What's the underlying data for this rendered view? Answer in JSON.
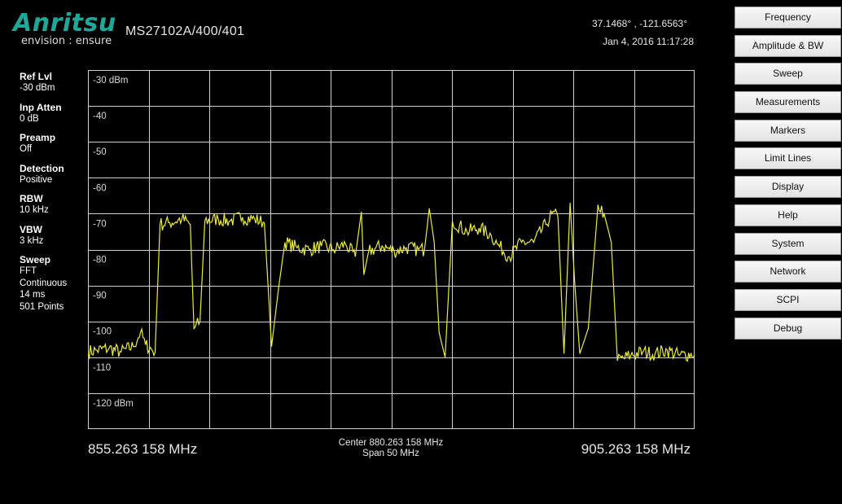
{
  "header": {
    "logo_text": "Anritsu",
    "tagline": "envision : ensure",
    "model": "MS27102A/400/401",
    "gps": "37.1468° , -121.6563°",
    "datetime": "Jan 4, 2016 11:17:28"
  },
  "params": [
    {
      "label": "Ref Lvl",
      "values": [
        "-30 dBm"
      ]
    },
    {
      "label": "Inp Atten",
      "values": [
        "0 dB"
      ]
    },
    {
      "label": "Preamp",
      "values": [
        "Off"
      ]
    },
    {
      "label": "Detection",
      "values": [
        "Positive"
      ]
    },
    {
      "label": "RBW",
      "values": [
        "10 kHz"
      ]
    },
    {
      "label": "VBW",
      "values": [
        "3 kHz"
      ]
    },
    {
      "label": "Sweep",
      "values": [
        "FFT",
        "Continuous",
        "14 ms",
        "501 Points"
      ]
    }
  ],
  "axis": {
    "y_labels": [
      "-30 dBm",
      "-40",
      "-50",
      "-60",
      "-70",
      "-80",
      "-90",
      "-100",
      "-110",
      "-120 dBm"
    ],
    "start_freq": "855.263 158 MHz",
    "stop_freq": "905.263 158 MHz",
    "center": "Center 880.263 158 MHz",
    "span": "Span 50 MHz"
  },
  "menu": [
    "Frequency",
    "Amplitude & BW",
    "Sweep",
    "Measurements",
    "Markers",
    "Limit Lines",
    "Display",
    "Help",
    "System",
    "Network",
    "SCPI",
    "Debug"
  ],
  "colors": {
    "trace": "#ecec3a",
    "grid": "#cfcfcf",
    "logo": "#1fa79a"
  },
  "chart_data": {
    "type": "line",
    "xlim": [
      855.263158,
      905.263158
    ],
    "ylim": [
      -130,
      -30
    ],
    "y_unit": "dBm",
    "grid": true,
    "series": [
      {
        "points": [
          [
            855.26,
            -108.5
          ],
          [
            856.0,
            -108.0
          ],
          [
            857.0,
            -107.5
          ],
          [
            858.0,
            -108.5
          ],
          [
            859.0,
            -107.0
          ],
          [
            859.6,
            -103.0
          ],
          [
            860.0,
            -106.5
          ],
          [
            860.8,
            -108.5
          ],
          [
            861.2,
            -73.0
          ],
          [
            862.0,
            -72.5
          ],
          [
            863.0,
            -71.5
          ],
          [
            863.7,
            -73.0
          ],
          [
            864.0,
            -102.0
          ],
          [
            864.5,
            -100.0
          ],
          [
            864.9,
            -72.0
          ],
          [
            866.0,
            -71.5
          ],
          [
            867.0,
            -72.0
          ],
          [
            868.0,
            -71.0
          ],
          [
            869.0,
            -71.5
          ],
          [
            869.8,
            -72.5
          ],
          [
            870.4,
            -107.0
          ],
          [
            871.0,
            -90.0
          ],
          [
            871.5,
            -78.0
          ],
          [
            872.5,
            -79.5
          ],
          [
            873.5,
            -80.0
          ],
          [
            874.5,
            -79.0
          ],
          [
            875.5,
            -80.0
          ],
          [
            876.5,
            -78.5
          ],
          [
            877.3,
            -82.0
          ],
          [
            877.8,
            -69.5
          ],
          [
            878.0,
            -87.0
          ],
          [
            878.4,
            -80.5
          ],
          [
            879.5,
            -79.0
          ],
          [
            880.5,
            -80.5
          ],
          [
            881.5,
            -79.5
          ],
          [
            882.5,
            -80.0
          ],
          [
            883.0,
            -80.0
          ],
          [
            883.4,
            -68.5
          ],
          [
            883.8,
            -78.0
          ],
          [
            884.2,
            -103.0
          ],
          [
            884.7,
            -110.0
          ],
          [
            885.3,
            -72.0
          ],
          [
            886.5,
            -75.0
          ],
          [
            887.5,
            -74.0
          ],
          [
            888.5,
            -76.0
          ],
          [
            889.0,
            -78.5
          ],
          [
            890.0,
            -82.0
          ],
          [
            891.0,
            -78.0
          ],
          [
            892.0,
            -78.0
          ],
          [
            893.0,
            -73.0
          ],
          [
            893.5,
            -70.0
          ],
          [
            894.0,
            -71.0
          ],
          [
            894.5,
            -109.0
          ],
          [
            895.0,
            -67.0
          ],
          [
            895.4,
            -90.0
          ],
          [
            895.8,
            -109.0
          ],
          [
            896.5,
            -102.0
          ],
          [
            897.3,
            -67.5
          ],
          [
            897.8,
            -70.0
          ],
          [
            898.4,
            -78.0
          ],
          [
            898.9,
            -111.0
          ],
          [
            900.0,
            -109.5
          ],
          [
            901.0,
            -108.5
          ],
          [
            902.0,
            -109.0
          ],
          [
            903.0,
            -108.0
          ],
          [
            904.0,
            -109.5
          ],
          [
            905.26,
            -109.0
          ]
        ]
      }
    ]
  }
}
